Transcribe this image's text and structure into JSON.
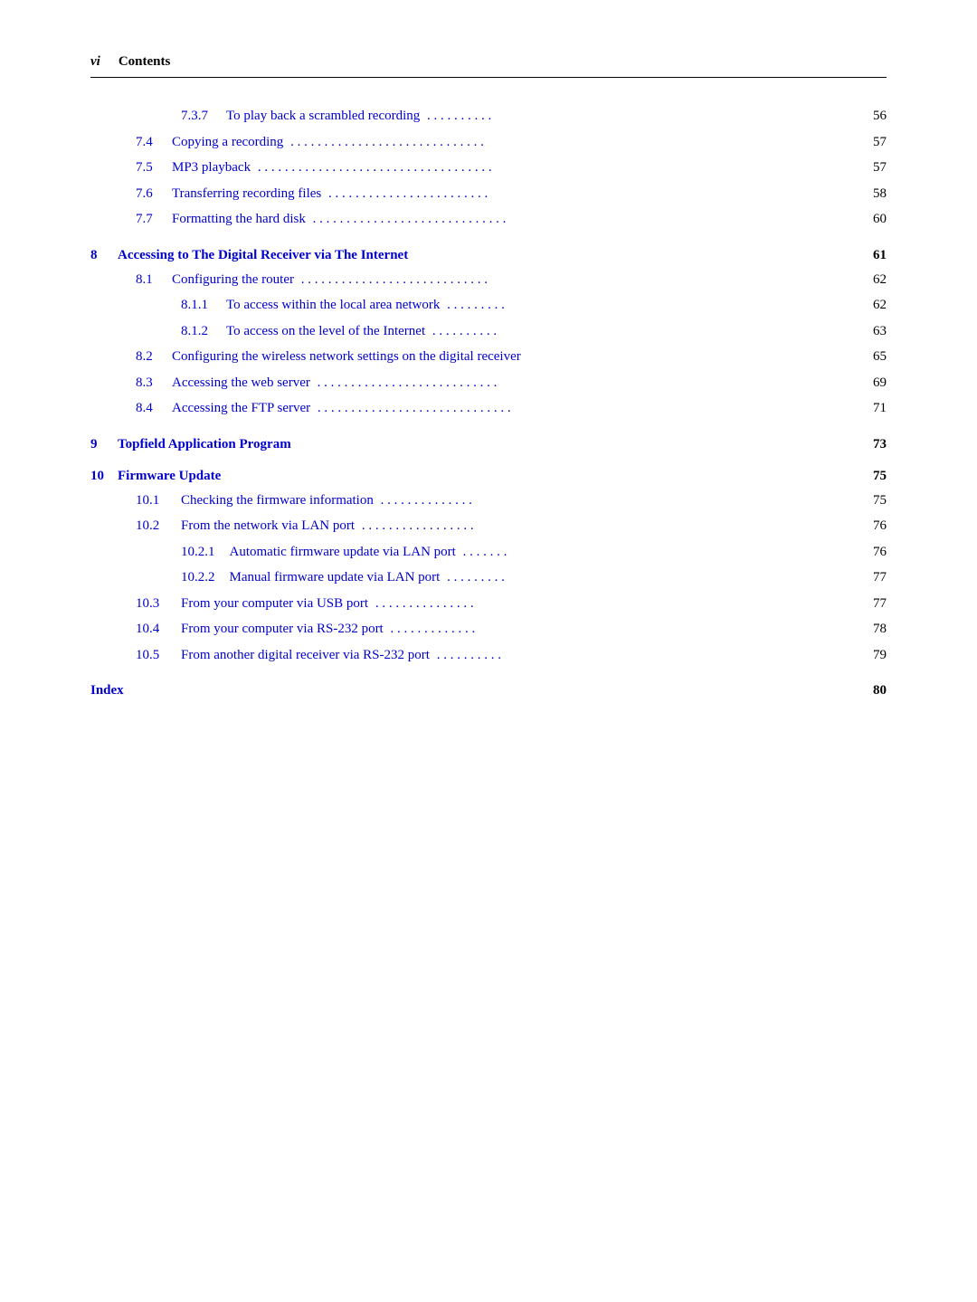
{
  "header": {
    "roman": "vi",
    "title": "Contents"
  },
  "entries": [
    {
      "type": "subsub",
      "number": "7.3.7",
      "label": "To play back a scrambled recording",
      "dots": ". . . . . . . . . .",
      "page": "56"
    },
    {
      "type": "sub",
      "number": "7.4",
      "label": "Copying a recording",
      "dots": ". . . . . . . . . . . . . . . . . . . . .",
      "page": "57"
    },
    {
      "type": "sub",
      "number": "7.5",
      "label": "MP3 playback",
      "dots": ". . . . . . . . . . . . . . . . . . . . . . . . .",
      "page": "57"
    },
    {
      "type": "sub",
      "number": "7.6",
      "label": "Transferring recording files",
      "dots": ". . . . . . . . . . . . . . . . . .",
      "page": "58"
    },
    {
      "type": "sub",
      "number": "7.7",
      "label": "Formatting the hard disk",
      "dots": ". . . . . . . . . . . . . . . . . . . . .",
      "page": "60"
    }
  ],
  "sections": [
    {
      "number": "8",
      "label": "Accessing to The Digital Receiver via The Internet",
      "page": "61",
      "subsections": [
        {
          "type": "sub",
          "number": "8.1",
          "label": "Configuring the router",
          "dots": ". . . . . . . . . . . . . . . . . . . . . . .",
          "page": "62",
          "children": [
            {
              "number": "8.1.1",
              "label": "To access within the local area network",
              "dots": ". . . . . . . . .",
              "page": "62"
            },
            {
              "number": "8.1.2",
              "label": "To access on the level of the Internet",
              "dots": ". . . . . . . . . .",
              "page": "63"
            }
          ]
        },
        {
          "type": "sub",
          "number": "8.2",
          "label": "Configuring the wireless network settings on the digital receiver",
          "dots": "",
          "page": "65",
          "children": []
        },
        {
          "type": "sub",
          "number": "8.3",
          "label": "Accessing the web server",
          "dots": ". . . . . . . . . . . . . . . . . . . .",
          "page": "69",
          "children": []
        },
        {
          "type": "sub",
          "number": "8.4",
          "label": "Accessing the FTP server",
          "dots": ". . . . . . . . . . . . . . . . . . . . .",
          "page": "71",
          "children": []
        }
      ]
    },
    {
      "number": "9",
      "label": "Topfield Application Program",
      "page": "73",
      "subsections": []
    },
    {
      "number": "10",
      "label": "Firmware Update",
      "page": "75",
      "subsections": [
        {
          "type": "sub",
          "number": "10.1",
          "label": "Checking the firmware information",
          "dots": ". . . . . . . . . . . . . .",
          "page": "75",
          "children": []
        },
        {
          "type": "sub",
          "number": "10.2",
          "label": "From the network via LAN port",
          "dots": ". . . . . . . . . . . . . . .",
          "page": "76",
          "children": [
            {
              "number": "10.2.1",
              "label": "Automatic firmware update via LAN port",
              "dots": ". . . . . . .",
              "page": "76"
            },
            {
              "number": "10.2.2",
              "label": "Manual firmware update via LAN port",
              "dots": ". . . . . . . .",
              "page": "77"
            }
          ]
        },
        {
          "type": "sub",
          "number": "10.3",
          "label": "From your computer via USB port",
          "dots": ". . . . . . . . . . . . . .",
          "page": "77",
          "children": []
        },
        {
          "type": "sub",
          "number": "10.4",
          "label": "From your computer via RS-232 port",
          "dots": ". . . . . . . . . . . . .",
          "page": "78",
          "children": []
        },
        {
          "type": "sub",
          "number": "10.5",
          "label": "From another digital receiver via RS-232 port",
          "dots": ". . . . . . . . . .",
          "page": "79",
          "children": []
        }
      ]
    }
  ],
  "index": {
    "label": "Index",
    "page": "80"
  }
}
